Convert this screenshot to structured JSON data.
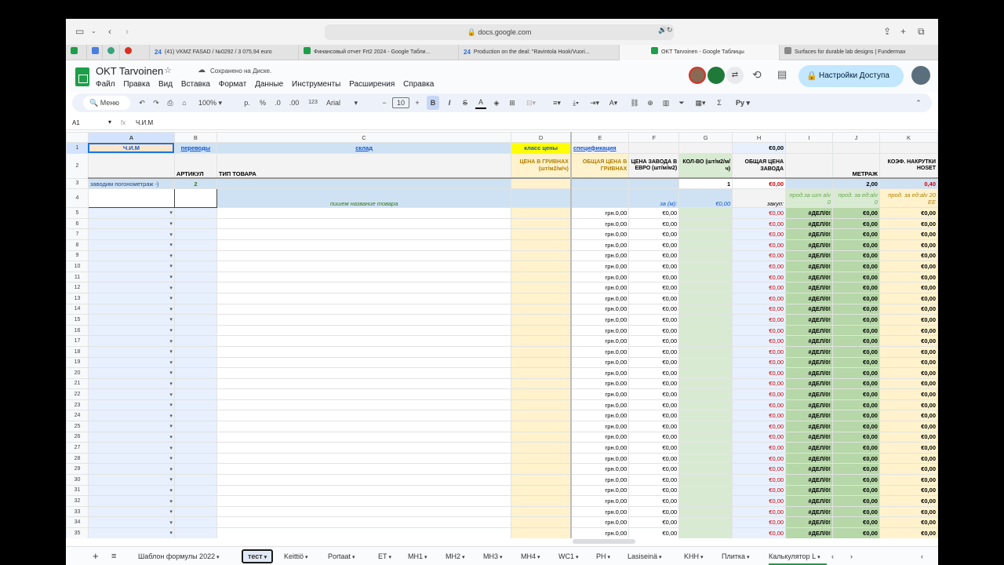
{
  "browser": {
    "url": "docs.google.com",
    "tabs": [
      {
        "label": "(41) VKMZ FASAD / №0292 / 3 075,94 euro"
      },
      {
        "label": "Финансовый отчет Frt2 2024 - Google Табли..."
      },
      {
        "label": "Production on the deal: \"Ravintola Hook/Vuori..."
      },
      {
        "label": "OKT Tarvoinen - Google Таблицы"
      },
      {
        "label": "Surfaces for durable lab designs | Fundermax"
      }
    ]
  },
  "app": {
    "title": "OKT Tarvoinen",
    "saved_status": "Сохранено на Диске.",
    "menu": [
      "Файл",
      "Правка",
      "Вид",
      "Вставка",
      "Формат",
      "Данные",
      "Инструменты",
      "Расширения",
      "Справка"
    ],
    "share_label": "Настройки Доступа"
  },
  "toolbar": {
    "menu_search": "Меню",
    "zoom": "100%",
    "currency": "р.",
    "percent": "%",
    "dec_less": ".0",
    "dec_more": ".00",
    "num_format": "123",
    "font": "Arial",
    "font_size": "10",
    "bold": "B",
    "italic": "I",
    "strike": "S",
    "textcolor": "A",
    "sum": "Σ",
    "input_tools": "Pу"
  },
  "formula_bar": {
    "cell_ref": "A1",
    "fx": "fx",
    "content": "Ч.И.М"
  },
  "columns": [
    "A",
    "B",
    "C",
    "D",
    "E",
    "F",
    "G",
    "H",
    "I",
    "J",
    "K"
  ],
  "header_rows": {
    "r1": {
      "A": "Ч.И.М",
      "B": "переводы",
      "C": "склад",
      "D": "класс цены",
      "E": "спецификация",
      "H": "€0,00"
    },
    "r2": {
      "B": "АРТИКУЛ",
      "C": "ТИП ТОВАРА",
      "D": "ЦЕНА В ГРИВНАХ (шт/м2/м/ч)",
      "E": "ОБЩАЯ ЦЕНА В ГРИВНАХ",
      "F": "ЦЕНА ЗАВОДА В ЕВРО (шт/м/м2)",
      "G": "КОЛ-ВО (шт/м2/м/ч)",
      "H": "ОБЩАЯ ЦЕНА ЗАВОДА",
      "J": "МЕТРАЖ",
      "K": "КОЭФ. НАКРУТКИ НОSЕТ"
    },
    "r3": {
      "A": "заводим погонометраж -)",
      "B": "2",
      "G": "1",
      "H": "€0,00",
      "J": "2,00",
      "K": "0,40"
    },
    "r4": {
      "C": "пишем название товара",
      "F": "за (м):",
      "G": "€0,00",
      "H": "закуп:",
      "I": "прод.за шт alv 0",
      "J": "прод. за ед:alv 0",
      "K": "прод. за ед:alv 20 ЕЕ"
    }
  },
  "row_values": {
    "E": "грн.0,00",
    "F": "€0,00",
    "H": "€0,00",
    "I": "#ДЕЛ/0!",
    "J": "€0,00",
    "K": "€0,00"
  },
  "data_row_numbers": [
    "5",
    "6",
    "7",
    "8",
    "9",
    "10",
    "11",
    "12",
    "13",
    "14",
    "15",
    "16",
    "17",
    "18",
    "19",
    "20",
    "21",
    "22",
    "23",
    "24",
    "25",
    "26",
    "27",
    "28",
    "29",
    "30",
    "31",
    "32",
    "33",
    "34",
    "35"
  ],
  "sheet_tabs": [
    "Шаблон формулы 2022",
    "тест",
    "Keittiö",
    "Portaat",
    "ET",
    "MH1",
    "MH2",
    "MH3",
    "MH4",
    "WC1",
    "PH",
    "Lasiseinä",
    "KHH",
    "Плитка",
    "Калькулятор L"
  ],
  "active_sheet": "тест"
}
